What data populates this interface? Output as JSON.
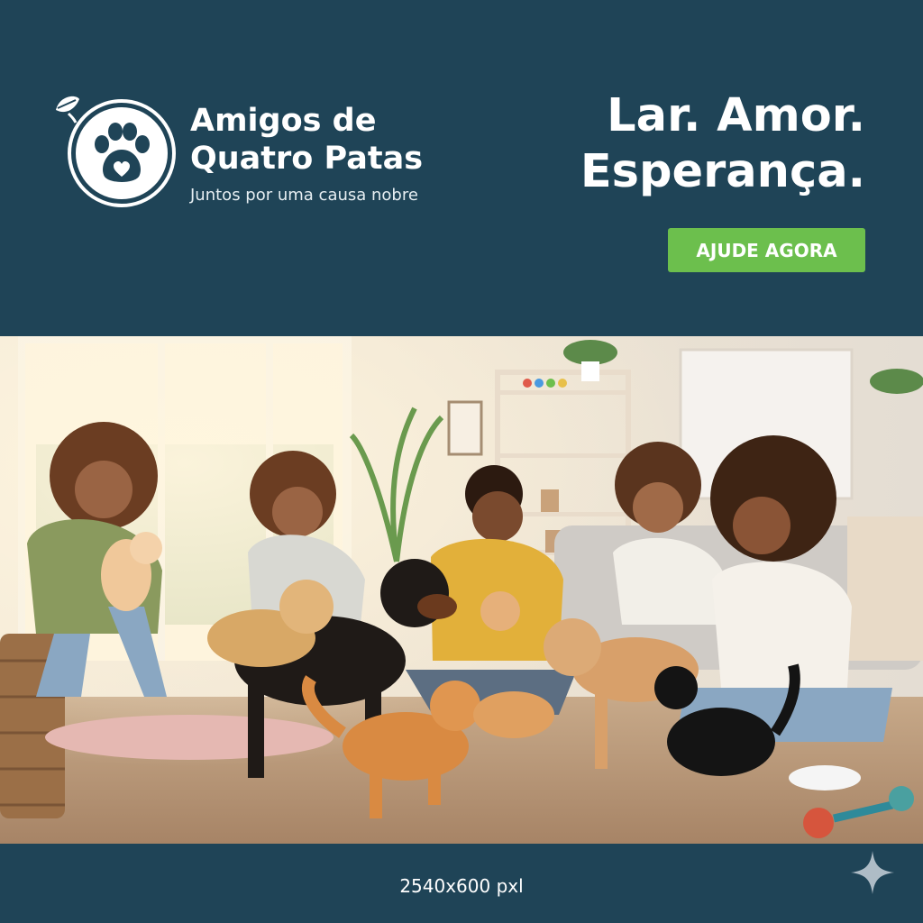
{
  "brand": {
    "name_line1": "Amigos de",
    "name_line2": "Quatro Patas",
    "tagline": "Juntos por uma causa nobre",
    "logo_icon": "paw-heart-leaf-icon"
  },
  "headline": {
    "line1": "Lar. Amor.",
    "line2": "Esperança."
  },
  "cta": {
    "label": "AJUDE AGORA"
  },
  "photo": {
    "subject": "group-volunteers-playing-with-dogs-and-cats"
  },
  "footer": {
    "dimensions_label": "2540x600 pxl",
    "corner_icon": "sparkle-icon"
  },
  "colors": {
    "background": "#1f4457",
    "accent_green": "#6cbf4d",
    "text": "#ffffff"
  }
}
